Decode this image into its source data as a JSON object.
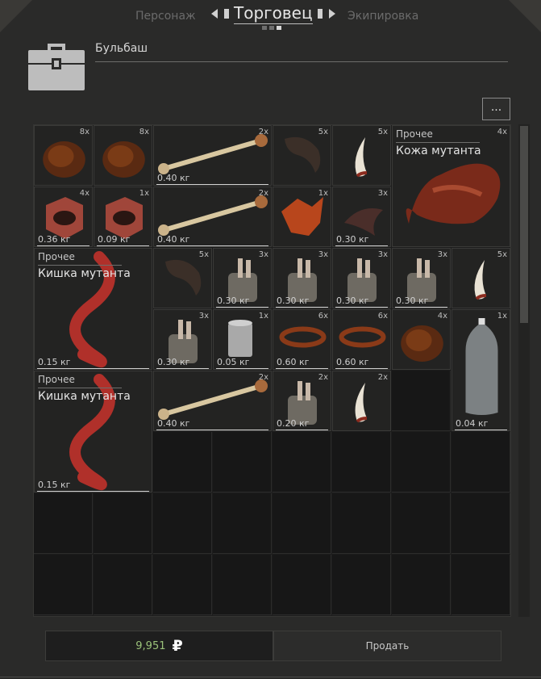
{
  "tabs": {
    "left": "Персонаж",
    "active": "Торговец",
    "right": "Экипировка"
  },
  "trader": {
    "name": "Бульбаш"
  },
  "more_button": "...",
  "items": [
    {
      "id": "fur1",
      "qty": "8x",
      "weight": "",
      "icon": "fur-icon"
    },
    {
      "id": "fur2",
      "qty": "8x",
      "weight": "",
      "icon": "fur-icon"
    },
    {
      "id": "bone1",
      "qty": "2x",
      "weight": "0.40 кг",
      "icon": "bone-icon"
    },
    {
      "id": "hoof1",
      "qty": "5x",
      "weight": "",
      "icon": "hoof-icon"
    },
    {
      "id": "claw1",
      "qty": "5x",
      "weight": "",
      "icon": "claw-icon"
    },
    {
      "id": "skin",
      "qty": "4x",
      "weight": "",
      "category": "Прочее",
      "name": "Кожа мутанта",
      "icon": "mutant-skin-icon"
    },
    {
      "id": "eye1",
      "qty": "4x",
      "weight": "0.36 кг",
      "icon": "eye-icon"
    },
    {
      "id": "eye2",
      "qty": "1x",
      "weight": "0.09 кг",
      "icon": "eye-icon"
    },
    {
      "id": "bone2",
      "qty": "2x",
      "weight": "0.40 кг",
      "icon": "bone-icon"
    },
    {
      "id": "flesh1",
      "qty": "1x",
      "weight": "",
      "icon": "flesh-icon"
    },
    {
      "id": "tentacle1",
      "qty": "3x",
      "weight": "0.30 кг",
      "icon": "tentacle-icon"
    },
    {
      "id": "gut1",
      "qty": "",
      "weight": "0.15 кг",
      "category": "Прочее",
      "name": "Кишка мутанта",
      "icon": "gut-icon"
    },
    {
      "id": "hoof2",
      "qty": "5x",
      "weight": "",
      "icon": "hoof-icon"
    },
    {
      "id": "hand1",
      "qty": "3x",
      "weight": "0.30 кг",
      "icon": "hand-icon"
    },
    {
      "id": "hand2",
      "qty": "3x",
      "weight": "0.30 кг",
      "icon": "hand-icon"
    },
    {
      "id": "hand3",
      "qty": "3x",
      "weight": "0.30 кг",
      "icon": "hand-icon"
    },
    {
      "id": "hand4",
      "qty": "3x",
      "weight": "0.30 кг",
      "icon": "hand-icon"
    },
    {
      "id": "claw2",
      "qty": "5x",
      "weight": "",
      "icon": "claw-icon"
    },
    {
      "id": "hand5",
      "qty": "3x",
      "weight": "0.30 кг",
      "icon": "hand-icon"
    },
    {
      "id": "can",
      "qty": "1x",
      "weight": "0.05 кг",
      "icon": "tin-can-icon"
    },
    {
      "id": "sausage1",
      "qty": "6x",
      "weight": "0.60 кг",
      "icon": "sausage-icon"
    },
    {
      "id": "sausage2",
      "qty": "6x",
      "weight": "0.60 кг",
      "icon": "sausage-icon"
    },
    {
      "id": "fur3",
      "qty": "4x",
      "weight": "",
      "icon": "fur-icon"
    },
    {
      "id": "bottle",
      "qty": "1x",
      "weight": "0.04 кг",
      "icon": "plastic-bottle-icon"
    },
    {
      "id": "gut2",
      "qty": "",
      "weight": "0.15 кг",
      "category": "Прочее",
      "name": "Кишка мутанта",
      "icon": "gut-icon"
    },
    {
      "id": "bone3",
      "qty": "2x",
      "weight": "0.40 кг",
      "icon": "bone-icon"
    },
    {
      "id": "hand6",
      "qty": "2x",
      "weight": "0.20 кг",
      "icon": "hand-icon"
    },
    {
      "id": "claw3",
      "qty": "2x",
      "weight": "",
      "icon": "claw-icon"
    }
  ],
  "footer": {
    "money": "9,951",
    "currency": "₽",
    "sell_label": "Продать"
  },
  "colors": {
    "money": "#9bc27a",
    "background": "#2a2a29"
  }
}
